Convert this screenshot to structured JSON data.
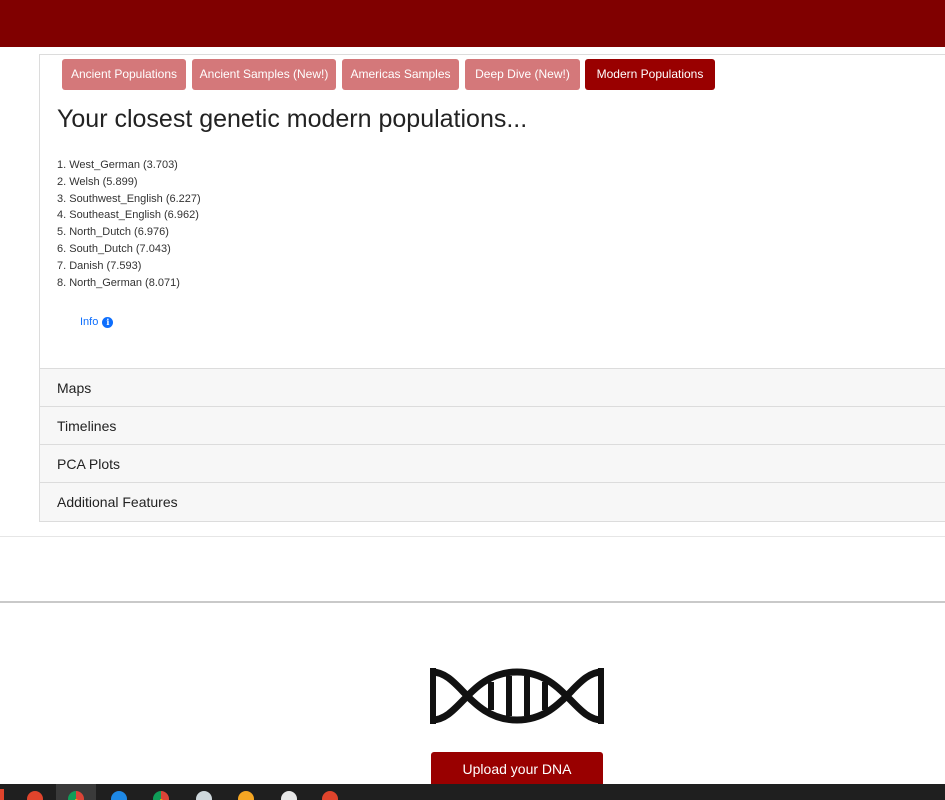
{
  "tabs": [
    {
      "label": "Ancient Populations",
      "active": false
    },
    {
      "label": "Ancient Samples (New!)",
      "active": false
    },
    {
      "label": "Americas Samples",
      "active": false
    },
    {
      "label": "Deep Dive (New!)",
      "active": false
    },
    {
      "label": "Modern Populations",
      "active": true
    }
  ],
  "results": {
    "heading": "Your closest genetic modern populations...",
    "populations": [
      "1. West_German (3.703)",
      "2. Welsh (5.899)",
      "3. Southwest_English (6.227)",
      "4. Southeast_English (6.962)",
      "5. North_Dutch (6.976)",
      "6. South_Dutch (7.043)",
      "7. Danish (7.593)",
      "8. North_German (8.071)"
    ],
    "info_label": "Info",
    "info_icon": "info-circle-icon"
  },
  "accordion": [
    "Maps",
    "Timelines",
    "PCA Plots",
    "Additional Features"
  ],
  "footer": {
    "logo_icon": "dna-helix-icon",
    "upload_label": "Upload your DNA"
  },
  "colors": {
    "brand": "#800000",
    "active_tab": "#990000",
    "inactive_tab": "#d4787a",
    "link": "#0d6efd"
  }
}
